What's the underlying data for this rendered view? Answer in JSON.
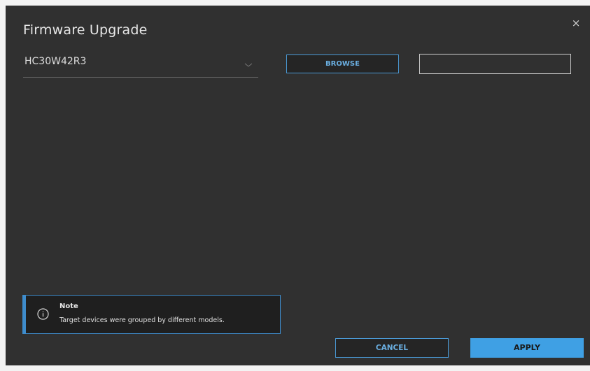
{
  "dialog": {
    "title": "Firmware Upgrade",
    "close_label": "×"
  },
  "model_select": {
    "value": "HC30W42R3",
    "icon": "chevron-down-icon"
  },
  "browse_button": {
    "label": "BROWSE"
  },
  "file_path": {
    "value": "",
    "placeholder": ""
  },
  "note": {
    "icon": "info-icon",
    "title": "Note",
    "text": "Target devices were grouped by different models."
  },
  "footer": {
    "cancel_label": "CANCEL",
    "apply_label": "APPLY"
  },
  "colors": {
    "dialog_bg": "#303030",
    "accent": "#3fa0e4",
    "outline_accent": "#4a9ad6"
  }
}
